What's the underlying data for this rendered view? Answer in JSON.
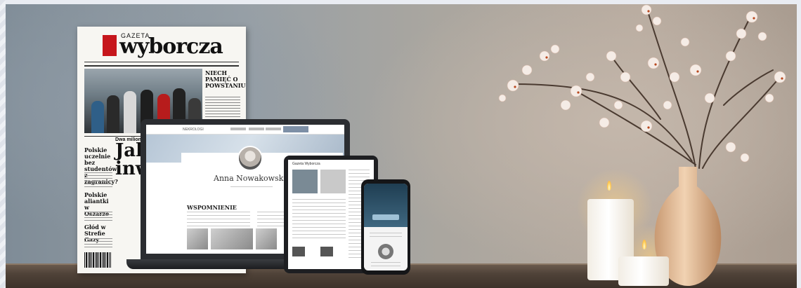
{
  "newspaper": {
    "masthead_small": "GAZETA",
    "masthead": "wyborcza",
    "side_headline": "NIECH PAMIĘĆ O POWSTANIU",
    "col1_headline": "Polskie uczelnie bez studentów z zagranicy?",
    "col2_headline": "Polskie aliantki w Oszarze",
    "col3_headline": "Głód w Strefie Gazy",
    "banner": "Dwa miliony",
    "lead_headline_1": "Jak p",
    "lead_headline_2": "inwi"
  },
  "laptop_site": {
    "logo": "NEKROLOGI",
    "person_name": "Anna Nowakowska",
    "section_title": "WSPOMNIENIE"
  },
  "tablet_site": {
    "header": "Gazeta Wyborcza"
  },
  "colors": {
    "masthead_red": "#c6161c",
    "wall": "#a9a39c",
    "shelf": "#4f4238",
    "device_dark": "#2b2d31"
  }
}
